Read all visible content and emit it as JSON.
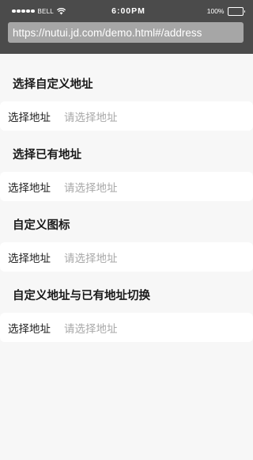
{
  "status_bar": {
    "carrier": "BELL",
    "time": "6:00PM",
    "battery": "100%",
    "battery_level_percent": 100,
    "signal_bars_filled": 5
  },
  "address_bar": {
    "url": "https://nutui.jd.com/demo.html#/address"
  },
  "sections": [
    {
      "title": "选择自定义地址",
      "cell_label": "选择地址",
      "cell_placeholder": "请选择地址"
    },
    {
      "title": "选择已有地址",
      "cell_label": "选择地址",
      "cell_placeholder": "请选择地址"
    },
    {
      "title": "自定义图标",
      "cell_label": "选择地址",
      "cell_placeholder": "请选择地址"
    },
    {
      "title": "自定义地址与已有地址切换",
      "cell_label": "选择地址",
      "cell_placeholder": "请选择地址"
    }
  ]
}
